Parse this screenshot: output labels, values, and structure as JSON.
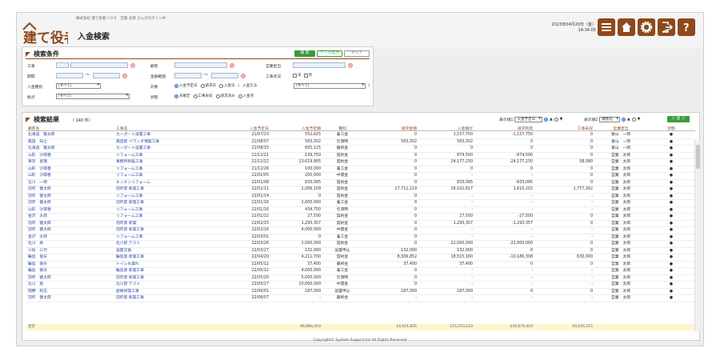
{
  "header": {
    "logo_text": "建て役者",
    "company": "株式会社 建て役者ハウス　営業 太郎 さんがログイン中",
    "title": "入金検索",
    "date": "2023年04月20日（金）",
    "time": "14:34:05"
  },
  "search": {
    "title": "検索条件",
    "btn_search": "検 索",
    "btn_export": "データ出力",
    "btn_clear": "クリア",
    "labels": {
      "koji": "工事",
      "customer": "顧客",
      "sales": "営業担当",
      "period": "期間",
      "region": "金額範囲",
      "completion": "工事状況",
      "payment_type": "入金種別",
      "target": "対象",
      "method": "入金方法",
      "branch": "拠点",
      "status": "状態"
    },
    "payment_type_value": "(すべて)",
    "branch_value": "(すべて)",
    "method_value": "(すべて)",
    "completion_opts": [
      "未",
      "済"
    ],
    "target_opts": [
      "入金予定日",
      "請求日",
      "入金日"
    ],
    "status_opts": [
      "未確定",
      "工事未収",
      "請求済み",
      "入金済"
    ],
    "tilde": "～",
    "paren_open": "(",
    "paren_close": ")",
    "clear_mark": "×"
  },
  "results": {
    "title": "検索結果",
    "count": "（ 140 件）",
    "disp1_label": "表示順1",
    "disp1_value": "入金予定日",
    "disp2_label": "表示順2",
    "disp2_value": "顧客名",
    "btn_input": "入 金 入",
    "sort_asc": "▲",
    "sort_desc": "▼",
    "columns": [
      "顧客名",
      "工事名",
      "入金予定日",
      "入金予定額",
      "種別",
      "請求金額",
      "入金額計",
      "請求残高",
      "工事未収",
      "営業担当",
      "状態"
    ],
    "rows": [
      [
        "北海道　賢太郎",
        "カーポート設置工事",
        "21/07/23",
        "552,625",
        "着工金",
        "0",
        "1,157,750",
        "-1,157,750",
        "0",
        "富山　一郎"
      ],
      [
        "霞田　知之",
        "霞田邸 ベランダ増築工事",
        "21/08/07",
        "583,302",
        "引渡時",
        "583,302",
        "583,302",
        "0",
        "0",
        "富山　一郎"
      ],
      [
        "北海道　賢太郎",
        "カーポート設置工事",
        "21/08/15",
        "605,125",
        "最終金",
        "0",
        "0",
        "0",
        "0",
        "富山　一郎"
      ],
      [
        "山形　沙耶香",
        "リフォーム工事",
        "21/12/21",
        "139,750",
        "契約金",
        "0",
        "874,500",
        "-874,500",
        "0",
        "営業　太郎"
      ],
      [
        "東京　武瑠",
        "事務所移転工事",
        "21/12/22",
        "13,619,905",
        "契約金",
        "0",
        "24,177,230",
        "-24,177,230",
        "58,080",
        "営業　太郎"
      ],
      [
        "山形　沙耶香",
        "リフォーム工事",
        "21/12/26",
        "100,000",
        "着工金",
        "0",
        "0",
        "0",
        "0",
        "営業　太郎"
      ],
      [
        "山形　沙耶香",
        "リフォーム工事",
        "22/01/05",
        "200,000",
        "中間金",
        "0",
        "-",
        "-",
        "0",
        "営業　太郎"
      ],
      [
        "石川　一郎",
        "キッチンリフォーム",
        "22/01/08",
        "833,095",
        "契約金",
        "0",
        "833,095",
        "-833,095",
        "0",
        "営業　太郎"
      ],
      [
        "羽咋　健太郎",
        "羽咋邸 新築工事",
        "22/01/11",
        "2,006,109",
        "契約金",
        "17,712,219",
        "16,102,617",
        "1,610,202",
        "1,777,262",
        "営業　太郎"
      ],
      [
        "羽咋　健太郎",
        "リフォーム工事",
        "22/01/14",
        "0",
        "契約金",
        "0",
        "-",
        "-",
        "-",
        "営業　太郎"
      ],
      [
        "羽咋　健太郎",
        "羽咋邸 新築工事",
        "22/01/16",
        "2,000,000",
        "着工金",
        "0",
        "-",
        "-",
        "-",
        "営業　太郎"
      ],
      [
        "山形　沙耶香",
        "リフォーム工事",
        "22/01/16",
        "434,750",
        "引渡時",
        "0",
        "-",
        "-",
        "-",
        "営業　太郎"
      ],
      [
        "金沢　太郎",
        "リフォーム工事",
        "22/01/22",
        "27,500",
        "契約金",
        "0",
        "27,500",
        "-27,500",
        "0",
        "営業　太郎"
      ],
      [
        "羽咋　健太郎",
        "羽咋邸 新築",
        "22/02/15",
        "1,293,357",
        "契約金",
        "0",
        "1,293,357",
        "-1,293,357",
        "0",
        "営業　太郎"
      ],
      [
        "羽咋　健太郎",
        "羽咋邸 新築工事",
        "22/02/16",
        "4,000,000",
        "中間金",
        "0",
        "-",
        "-",
        "-",
        "営業　太郎"
      ],
      [
        "金沢　太郎",
        "リフォーム工事",
        "22/03/01",
        "0",
        "着工金",
        "0",
        "-",
        "-",
        "-",
        "営業　太郎"
      ],
      [
        "北川　真",
        "北川邸 テスト",
        "22/03/26",
        "2,000,000",
        "契約金",
        "0",
        "22,000,000",
        "-22,000,000",
        "0",
        "営業　太郎"
      ],
      [
        "小松　三代",
        "設置交換",
        "22/03/27",
        "132,000",
        "設置申込",
        "132,000",
        "132,000",
        "0",
        "0",
        "営業　太郎"
      ],
      [
        "輪島　鉄矢",
        "輪島邸 新築工事",
        "22/04/20",
        "4,211,700",
        "契約金",
        "8,306,852",
        "18,515,160",
        "-10,180,308",
        "630,000",
        "営業　太郎"
      ],
      [
        "輪島　鉄矢",
        "トイレ水漏れ",
        "22/05/12",
        "37,400",
        "最終金",
        "37,400",
        "37,400",
        "0",
        "0",
        "営業　太郎"
      ],
      [
        "輪島　鉄矢",
        "輪島邸 新築工事",
        "22/05/12",
        "4,000,000",
        "着工金",
        "0",
        "-",
        "-",
        "-",
        "営業　太郎"
      ],
      [
        "羽咋　健太郎",
        "羽咋邸 新築工事",
        "22/05/20",
        "5,000,000",
        "引渡時",
        "0",
        "-",
        "-",
        "-",
        "営業　太郎"
      ],
      [
        "北川　真",
        "北川邸 テスト",
        "22/05/27",
        "10,000,000",
        "中間金",
        "0",
        "-",
        "-",
        "-",
        "営業　太郎"
      ],
      [
        "岡野　和志",
        "屋根修理工事",
        "22/06/01",
        "187,000",
        "設置申込",
        "187,000",
        "187,000",
        "0",
        "0",
        "営業　太郎"
      ],
      [
        "羽咋　健太郎",
        "羽咋邸 新築工事",
        "22/06/07",
        "-",
        "最終金",
        "-",
        "-",
        "-",
        "-",
        "営業　太郎"
      ]
    ],
    "total_label": "合計",
    "totals": [
      "",
      "",
      "96,884,410",
      "",
      "14,931,835",
      "155,553,110",
      "-334,676,410",
      "93,105,215",
      "",
      ""
    ],
    "status_mark": "●"
  },
  "footer": "Copyright© System Support,Inc All Rights Reserved"
}
